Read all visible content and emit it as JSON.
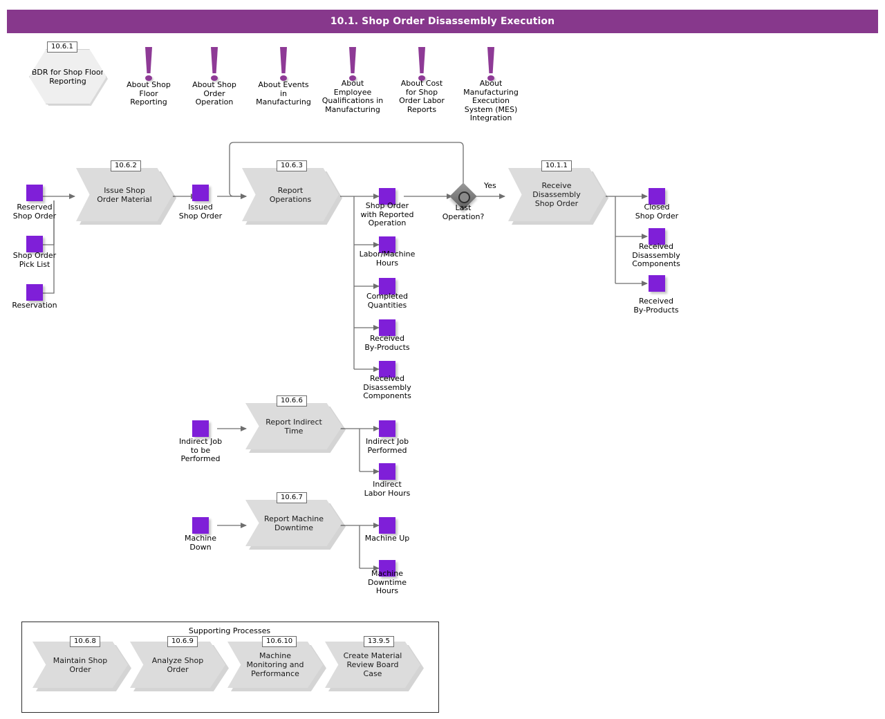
{
  "header": {
    "title": "10.1. Shop Order Disassembly Execution",
    "bar_color": "#87388C"
  },
  "colors": {
    "data_square": "#7F1FD8",
    "process_fill": "#DCDCDC",
    "hexagon_fill": "#EFEFEF",
    "info_marker": "#8E3A96",
    "connector": "#6E6E6E"
  },
  "bdr": {
    "id": "10.6.1",
    "label": "BDR for Shop Floor\nReporting"
  },
  "info_markers": [
    {
      "icon": "exclamation-icon",
      "label": "About Shop\nFloor\nReporting"
    },
    {
      "icon": "exclamation-icon",
      "label": "About Shop\nOrder\nOperation"
    },
    {
      "icon": "exclamation-icon",
      "label": "About Events\nin\nManufacturing"
    },
    {
      "icon": "exclamation-icon",
      "label": "About\nEmployee\nQualifications in\nManufacturing"
    },
    {
      "icon": "exclamation-icon",
      "label": "About Cost\nfor Shop\nOrder Labor\nReports"
    },
    {
      "icon": "exclamation-icon",
      "label": "About\nManufacturing\nExecution\nSystem (MES)\nIntegration"
    }
  ],
  "processes": [
    {
      "id": "10.6.2",
      "label": "Issue Shop\nOrder Material"
    },
    {
      "id": "10.6.3",
      "label": "Report\nOperations"
    },
    {
      "id": "10.1.1",
      "label": "Receive\nDisassembly\nShop Order"
    },
    {
      "id": "10.6.6",
      "label": "Report Indirect\nTime"
    },
    {
      "id": "10.6.7",
      "label": "Report Machine\nDowntime"
    }
  ],
  "decision": {
    "label": "Last\nOperation?",
    "yes_label": "Yes"
  },
  "inputs_left": [
    {
      "label": "Reserved\nShop Order"
    },
    {
      "label": "Shop Order\nPick List"
    },
    {
      "label": "Reservation"
    }
  ],
  "issued": {
    "label": "Issued\nShop Order"
  },
  "report_operations_outputs": [
    {
      "label": "Shop Order\nwith Reported\nOperation"
    },
    {
      "label": "Labor/Machine\nHours"
    },
    {
      "label": "Completed\nQuantities"
    },
    {
      "label": "Received\nBy-Products"
    },
    {
      "label": "Received\nDisassembly\nComponents"
    }
  ],
  "receive_outputs": [
    {
      "label": "Closed\nShop Order"
    },
    {
      "label": "Received\nDisassembly\nComponents"
    },
    {
      "label": "Received\nBy-Products"
    }
  ],
  "indirect": {
    "input": {
      "label": "Indirect Job\nto be\nPerformed"
    },
    "outputs": [
      {
        "label": "Indirect Job\nPerformed"
      },
      {
        "label": "Indirect\nLabor Hours"
      }
    ]
  },
  "downtime": {
    "input": {
      "label": "Machine\nDown"
    },
    "outputs": [
      {
        "label": "Machine Up"
      },
      {
        "label": "Machine\nDowntime\nHours"
      }
    ]
  },
  "supporting": {
    "title": "Supporting Processes",
    "items": [
      {
        "id": "10.6.8",
        "label": "Maintain Shop\nOrder"
      },
      {
        "id": "10.6.9",
        "label": "Analyze Shop\nOrder"
      },
      {
        "id": "10.6.10",
        "label": "Machine\nMonitoring and\nPerformance"
      },
      {
        "id": "13.9.5",
        "label": "Create Material\nReview Board\nCase"
      }
    ]
  }
}
